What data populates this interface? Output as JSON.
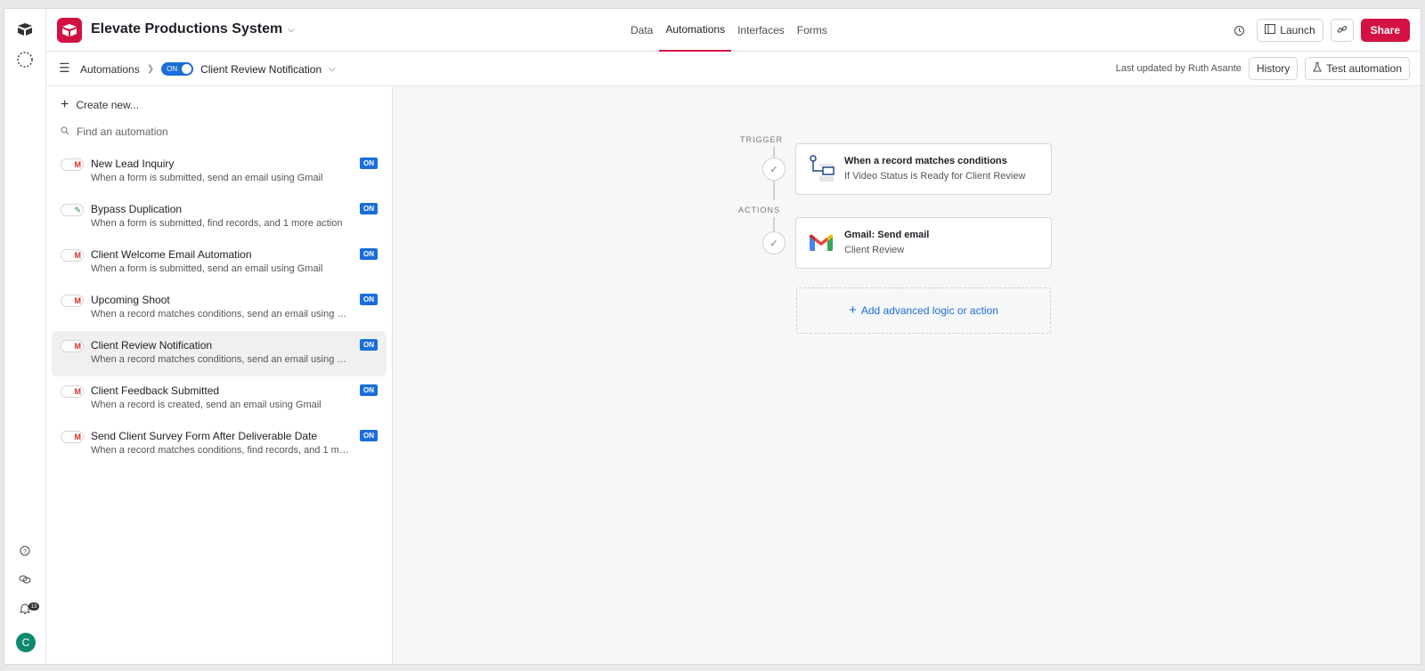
{
  "app": {
    "base_name": "Elevate Productions System"
  },
  "tabs": [
    {
      "label": "Data"
    },
    {
      "label": "Automations"
    },
    {
      "label": "Interfaces"
    },
    {
      "label": "Forms"
    }
  ],
  "toolbar": {
    "launch_label": "Launch",
    "share_label": "Share"
  },
  "subheader": {
    "breadcrumb_root": "Automations",
    "toggle_label": "ON",
    "current_automation": "Client Review Notification",
    "last_updated": "Last updated by Ruth Asante",
    "history_label": "History",
    "test_label": "Test automation"
  },
  "sidebar": {
    "create_label": "Create new...",
    "search_placeholder": "Find an automation",
    "badge_label": "ON",
    "items": [
      {
        "name": "New Lead Inquiry",
        "desc": "When a form is submitted, send an email using Gmail",
        "icon": "gmail-icon"
      },
      {
        "name": "Bypass Duplication",
        "desc": "When a form is submitted, find records, and 1 more action",
        "icon": "pencil-icon"
      },
      {
        "name": "Client Welcome Email Automation",
        "desc": "When a form is submitted, send an email using Gmail",
        "icon": "gmail-icon"
      },
      {
        "name": "Upcoming Shoot",
        "desc": "When a record matches conditions, send an email using Gm...",
        "icon": "gmail-icon"
      },
      {
        "name": "Client Review Notification",
        "desc": "When a record matches conditions, send an email using Gm...",
        "icon": "gmail-icon"
      },
      {
        "name": "Client Feedback Submitted",
        "desc": "When a record is created, send an email using Gmail",
        "icon": "gmail-icon"
      },
      {
        "name": "Send Client Survey Form After Deliverable Date",
        "desc": "When a record matches conditions, find records, and 1 more...",
        "icon": "gmail-icon"
      }
    ]
  },
  "flow": {
    "trigger_label": "TRIGGER",
    "actions_label": "ACTIONS",
    "trigger": {
      "title": "When a record matches conditions",
      "subtitle": "If Video Status is Ready for Client Review"
    },
    "action": {
      "title": "Gmail: Send email",
      "subtitle": "Client Review"
    },
    "add_label": "Add advanced logic or action"
  },
  "rail": {
    "notification_count": "13",
    "avatar_initial": "C"
  },
  "colors": {
    "brand": "#d31142",
    "accent": "#1a6ed8",
    "avatar": "#0f8a6f"
  }
}
